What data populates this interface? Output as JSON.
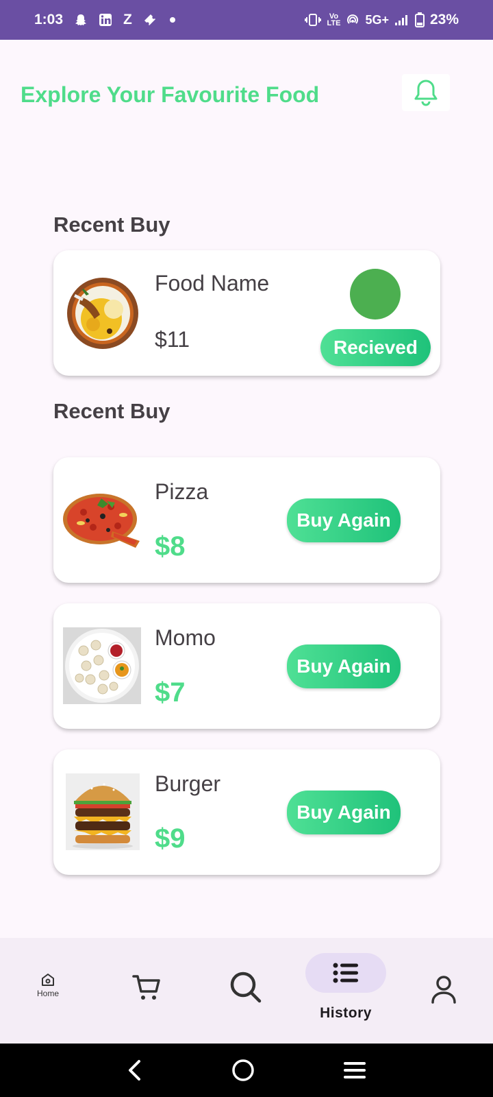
{
  "status_bar": {
    "time": "1:03",
    "notification_icons": [
      "snapchat-icon",
      "linkedin-icon",
      "z-icon",
      "ticket-icon",
      "dot-icon"
    ],
    "network": "5G+",
    "battery": "23%"
  },
  "header": {
    "title": "Explore Your Favourite Food"
  },
  "recent_section": {
    "title": "Recent Buy",
    "item": {
      "name": "Food Name",
      "price": "$11",
      "status_label": "Recieved",
      "status_color": "#4caf50"
    }
  },
  "history_section": {
    "title": "Recent Buy",
    "items": [
      {
        "name": "Pizza",
        "price": "$8",
        "button": "Buy Again"
      },
      {
        "name": "Momo",
        "price": "$7",
        "button": "Buy Again"
      },
      {
        "name": "Burger",
        "price": "$9",
        "button": "Buy Again"
      }
    ]
  },
  "bottom_nav": {
    "home_label": "Home",
    "history_label": "History",
    "active": "History"
  },
  "colors": {
    "accent_green": "#4fdc8a",
    "status_bar": "#6a4fa3",
    "active_pill": "#e6dcf4"
  }
}
